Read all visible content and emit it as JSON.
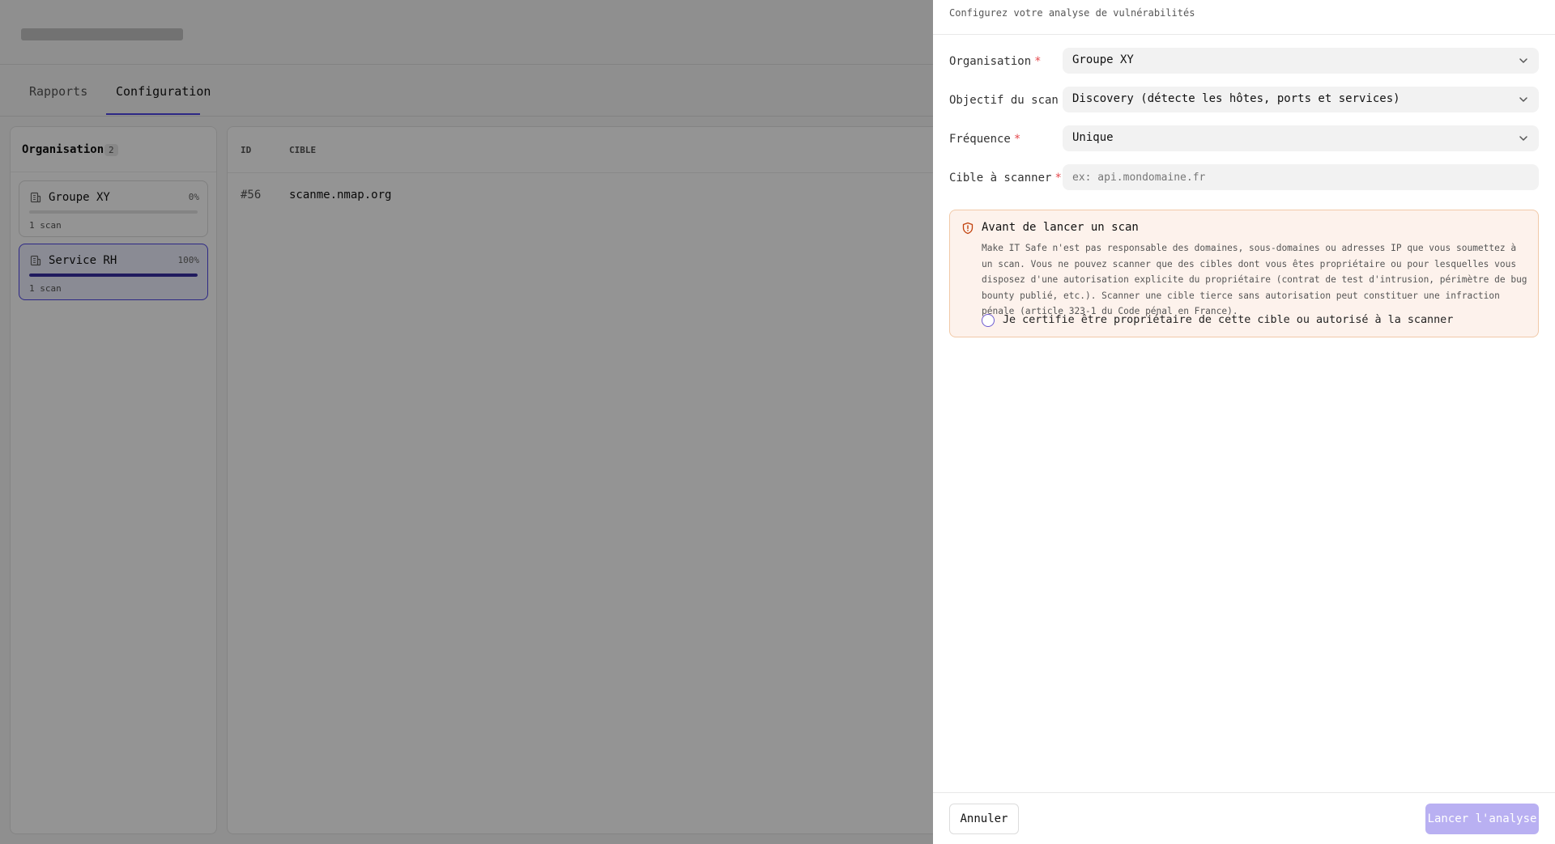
{
  "app": {
    "tabs": [
      {
        "label": "Rapports",
        "active": false
      },
      {
        "label": "Configuration",
        "active": true
      }
    ],
    "organisations": {
      "title": "Organisations",
      "count": "2",
      "items": [
        {
          "name": "Groupe XY",
          "percent_label": "0%",
          "progress": 0,
          "scans": "1 scan",
          "selected": false
        },
        {
          "name": "Service RH",
          "percent_label": "100%",
          "progress": 100,
          "scans": "1 scan",
          "selected": true
        }
      ]
    },
    "scans_table": {
      "columns": [
        "ID",
        "CIBLE"
      ],
      "rows": [
        {
          "id": "#56",
          "target": "scanme.nmap.org"
        }
      ]
    }
  },
  "drawer": {
    "subtitle": "Configurez votre analyse de vulnérabilités",
    "fields": {
      "organisation": {
        "label": "Organisation",
        "required_mark": "*",
        "value": "Groupe XY"
      },
      "objective": {
        "label": "Objectif du scan",
        "required_mark": "*",
        "value": "Discovery (détecte les hôtes, ports et services)"
      },
      "frequency": {
        "label": "Fréquence",
        "required_mark": "*",
        "value": "Unique"
      },
      "target": {
        "label": "Cible à scanner",
        "required_mark": "*",
        "value": "",
        "placeholder": "ex: api.mondomaine.fr"
      }
    },
    "warning": {
      "title": "Avant de lancer un scan",
      "body": "Make IT Safe n'est pas responsable des domaines, sous-domaines ou adresses IP que vous soumettez à un scan. Vous ne pouvez scanner que des cibles dont vous êtes propriétaire ou pour lesquelles vous disposez d'une autorisation explicite du propriétaire (contrat de test d'intrusion, périmètre de bug bounty publié, etc.). Scanner une cible tierce sans autorisation peut constituer une infraction pénale (article 323-1 du Code pénal en France).",
      "certify_label": "Je certifie être propriétaire de cette cible ou autorisé à la scanner",
      "certified": false
    },
    "footer": {
      "cancel_label": "Annuler",
      "launch_label": "Lancer l'analyse"
    }
  },
  "colors": {
    "accent": "#4f46e5",
    "required": "#e5484d",
    "launch_disabled": "#b9b0f2",
    "warning_bg": "#fdf2ec",
    "warning_border": "#f1c9a8"
  }
}
